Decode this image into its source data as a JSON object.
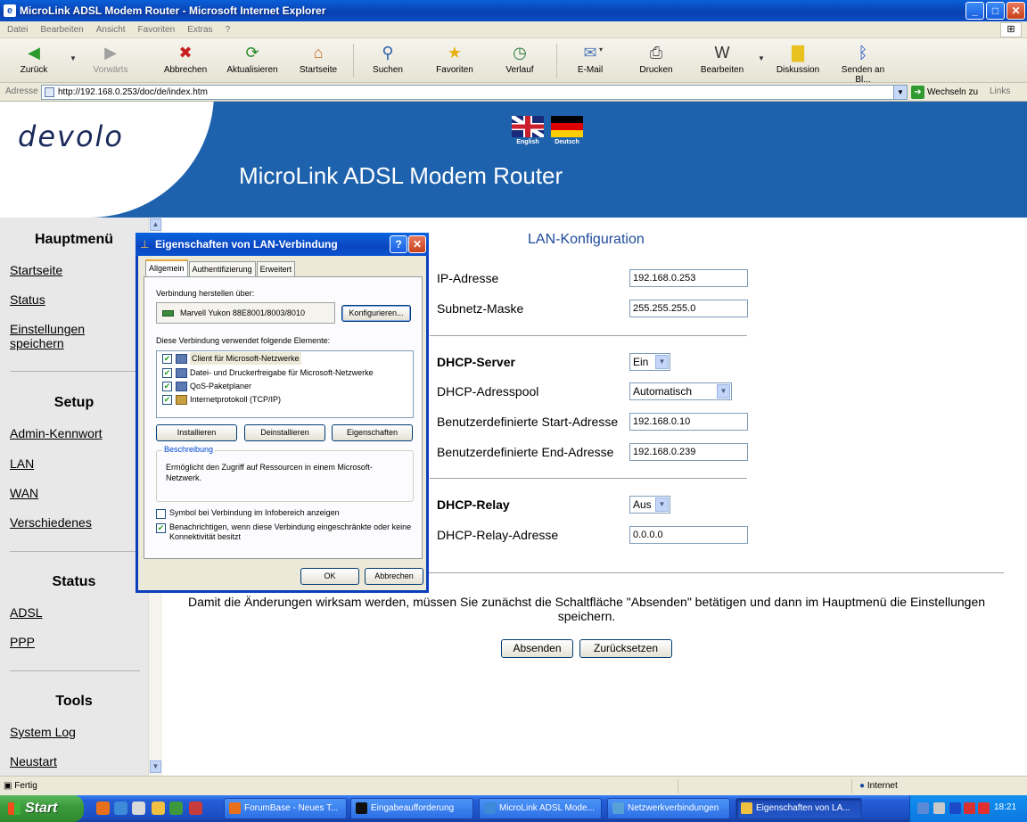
{
  "window": {
    "title": "MicroLink ADSL Modem Router - Microsoft Internet Explorer",
    "buttons": {
      "minimize": "_",
      "maximize": "□",
      "close": "✕"
    }
  },
  "menu": [
    "Datei",
    "Bearbeiten",
    "Ansicht",
    "Favoriten",
    "Extras",
    "?"
  ],
  "toolbar": {
    "back": "Zurück",
    "forward": "Vorwärts",
    "stop": "Abbrechen",
    "refresh": "Aktualisieren",
    "home": "Startseite",
    "search": "Suchen",
    "favorites": "Favoriten",
    "history": "Verlauf",
    "mail": "E-Mail",
    "print": "Drucken",
    "edit": "Bearbeiten",
    "discuss": "Diskussion",
    "bluetooth": "Senden an Bl..."
  },
  "address": {
    "label": "Adresse",
    "url": "http://192.168.0.253/doc/de/index.htm",
    "go": "Wechseln zu",
    "links": "Links"
  },
  "page": {
    "logo": "devolo",
    "router_title": "MicroLink ADSL Modem Router",
    "flags": {
      "english": "English",
      "german": "Deutsch"
    },
    "sidebar": {
      "main_head": "Hauptmenü",
      "main_links": [
        "Startseite",
        "Status",
        "Einstellungen speichern"
      ],
      "setup_head": "Setup",
      "setup_links": [
        "Admin-Kennwort",
        "LAN",
        "WAN",
        "Verschiedenes"
      ],
      "status_head": "Status",
      "status_links": [
        "ADSL",
        "PPP"
      ],
      "tools_head": "Tools",
      "tools_links": [
        "System Log",
        "Neustart"
      ]
    },
    "lan": {
      "title": "LAN-Konfiguration",
      "ip_label": "IP-Adresse",
      "ip_value": "192.168.0.253",
      "mask_label": "Subnetz-Maske",
      "mask_value": "255.255.255.0",
      "dhcp_server_label": "DHCP-Server",
      "dhcp_server_value": "Ein",
      "pool_label": "DHCP-Adresspool",
      "pool_value": "Automatisch",
      "start_label": "Benutzerdefinierte Start-Adresse",
      "start_value": "192.168.0.10",
      "end_label": "Benutzerdefinierte End-Adresse",
      "end_value": "192.168.0.239",
      "relay_label": "DHCP-Relay",
      "relay_value": "Aus",
      "relay_addr_label": "DHCP-Relay-Adresse",
      "relay_addr_value": "0.0.0.0",
      "note": "Damit die Änderungen wirksam werden, müssen Sie zunächst die Schaltfläche \"Absenden\" betätigen und dann im Hauptmenü die Einstellungen speichern.",
      "submit": "Absenden",
      "reset": "Zurücksetzen"
    }
  },
  "dialog": {
    "title": "Eigenschaften von LAN-Verbindung",
    "help": "?",
    "close": "✕",
    "tabs": [
      "Allgemein",
      "Authentifizierung",
      "Erweitert"
    ],
    "connect_via_label": "Verbindung herstellen über:",
    "adapter": "Marvell Yukon 88E8001/8003/8010",
    "configure": "Konfigurieren...",
    "elements_label": "Diese Verbindung verwendet folgende Elemente:",
    "items": [
      {
        "label": "Client für Microsoft-Netzwerke",
        "checked": true
      },
      {
        "label": "Datei- und Druckerfreigabe für Microsoft-Netzwerke",
        "checked": true
      },
      {
        "label": "QoS-Paketplaner",
        "checked": true
      },
      {
        "label": "Internetprotokoll (TCP/IP)",
        "checked": true
      }
    ],
    "install": "Installieren",
    "uninstall": "Deinstallieren",
    "properties": "Eigenschaften",
    "desc_legend": "Beschreibung",
    "desc_text": "Ermöglicht den Zugriff auf Ressourcen in einem Microsoft-Netzwerk.",
    "show_icon": "Symbol bei Verbindung im Infobereich anzeigen",
    "show_icon_checked": false,
    "notify": "Benachrichtigen, wenn diese Verbindung eingeschränkte oder keine Konnektivität besitzt",
    "notify_checked": true,
    "ok": "OK",
    "cancel": "Abbrechen"
  },
  "status": {
    "left": "Fertig",
    "zone": "Internet"
  },
  "taskbar": {
    "start": "Start",
    "tasks": [
      "ForumBase - Neues T...",
      "Eingabeaufforderung",
      "MicroLink ADSL Mode...",
      "Netzwerkverbindungen",
      "Eigenschaften von LA..."
    ],
    "clock": "18:21"
  }
}
